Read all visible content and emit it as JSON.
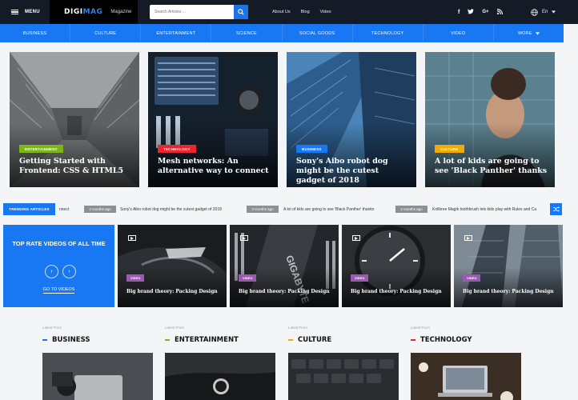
{
  "header": {
    "menu_label": "MENU",
    "logo_prefix": "DIGI",
    "logo_suffix": "MAG",
    "logo_sub": "Magazine",
    "search_placeholder": "Search Articles ...",
    "links": [
      "About Us",
      "Blog",
      "Video"
    ],
    "social_icons": [
      "facebook-icon",
      "twitter-icon",
      "google-plus-icon",
      "rss-icon"
    ],
    "language": "En"
  },
  "nav": {
    "items": [
      "BUSINESS",
      "CULTURE",
      "ENTERTAINMENT",
      "SCIENCE",
      "SOCIAL GOODS",
      "TECHNOLOGY",
      "VIDEO",
      "MORE"
    ]
  },
  "featured": [
    {
      "category": "ENTERTAINMENT",
      "color": "#7cb518",
      "title": "Getting Started with Frontend: CSS & HTML5"
    },
    {
      "category": "TECHNOLOGY",
      "color": "#e8262f",
      "title": "Mesh networks: An alternative way to connect"
    },
    {
      "category": "BUSINESS",
      "color": "#1877f2",
      "title": "Sony's Aibo robot dog might be the cutest gadget of 2018"
    },
    {
      "category": "CULTURE",
      "color": "#f2a900",
      "title": "A lot of kids are going to see 'Black Panther' thanks"
    }
  ],
  "trending": {
    "label": "TRENDING ARTICLES",
    "items": [
      {
        "date": "",
        "text": "nnect"
      },
      {
        "date": "2 months ago",
        "text": "Sony's Aibo robot dog might be the cutest gadget of 2018"
      },
      {
        "date": "3 months ago",
        "text": "A lot of kids are going to see 'Black Panther' thanks"
      },
      {
        "date": "2 months ago",
        "text": "Kolibree Magik toothbrush lets kids play with Rules and Ca"
      }
    ]
  },
  "videos": {
    "promo_title": "TOP RATE VIDEOS OF ALL TIME",
    "goto_label": "GO TO VIDEOS",
    "items": [
      {
        "badge": "VIDEO",
        "title": "Big brand theory: Packing Design"
      },
      {
        "badge": "VIDEO",
        "title": "Big brand theory: Packing Design"
      },
      {
        "badge": "VIDEO",
        "title": "Big brand theory: Packing Design"
      },
      {
        "badge": "VIDEO",
        "title": "Big brand theory: Packing Design"
      }
    ]
  },
  "categories": [
    {
      "from": "Latest From",
      "name": "BUSINESS",
      "color": "#1877f2"
    },
    {
      "from": "Latest From",
      "name": "ENTERTAINMENT",
      "color": "#7cb518"
    },
    {
      "from": "Latest From",
      "name": "CULTURE",
      "color": "#f2a900"
    },
    {
      "from": "Latest From",
      "name": "TECHNOLOGY",
      "color": "#e8262f"
    }
  ]
}
